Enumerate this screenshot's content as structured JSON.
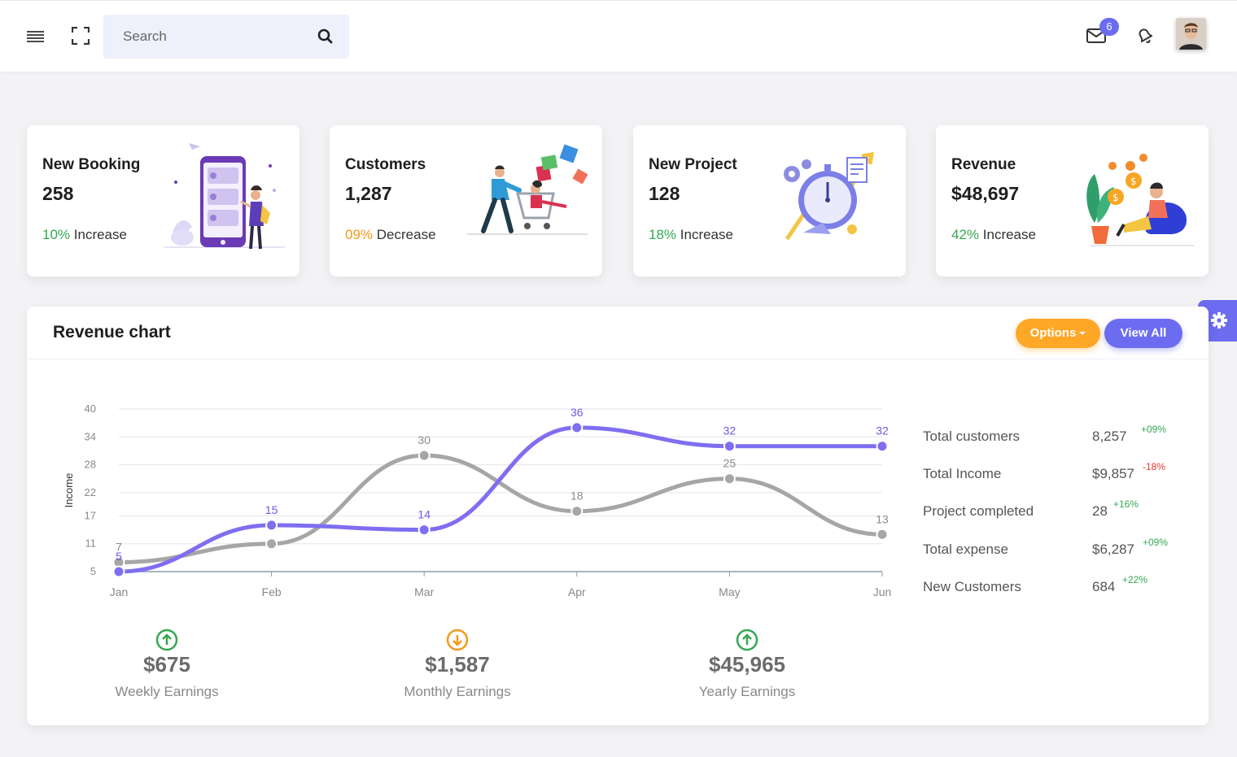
{
  "header": {
    "search_placeholder": "Search",
    "mail_count": "6"
  },
  "cards": [
    {
      "title": "New Booking",
      "value": "258",
      "change_pct": "10%",
      "change_word": "Increase",
      "direction": "up"
    },
    {
      "title": "Customers",
      "value": "1,287",
      "change_pct": "09%",
      "change_word": "Decrease",
      "direction": "down"
    },
    {
      "title": "New Project",
      "value": "128",
      "change_pct": "18%",
      "change_word": "Increase",
      "direction": "up"
    },
    {
      "title": "Revenue",
      "value": "$48,697",
      "change_pct": "42%",
      "change_word": "Increase",
      "direction": "up"
    }
  ],
  "panel": {
    "title": "Revenue chart",
    "options_label": "Options",
    "viewall_label": "View All"
  },
  "chart_data": {
    "type": "line",
    "categories": [
      "Jan",
      "Feb",
      "Mar",
      "Apr",
      "May",
      "Jun"
    ],
    "ylabel": "Income",
    "yticks": [
      "5",
      "11",
      "17",
      "22",
      "28",
      "34",
      "40"
    ],
    "ylim": [
      5,
      40
    ],
    "series": [
      {
        "values": [
          7,
          11,
          30,
          18,
          25,
          13
        ],
        "color": "#a6a6a6",
        "labels": [
          "7",
          "",
          "30",
          "18",
          "25",
          "13"
        ]
      },
      {
        "values": [
          5,
          15,
          14,
          36,
          32,
          32
        ],
        "color": "#7f6ef0",
        "labels": [
          "5",
          "15",
          "14",
          "36",
          "32",
          "32"
        ]
      }
    ],
    "grid": true
  },
  "stats": [
    {
      "label": "Total customers",
      "value": "8,257",
      "delta": "+09%",
      "sign": "pos"
    },
    {
      "label": "Total Income",
      "value": "$9,857",
      "delta": "-18%",
      "sign": "neg"
    },
    {
      "label": "Project completed",
      "value": "28",
      "delta": "+16%",
      "sign": "pos"
    },
    {
      "label": "Total expense",
      "value": "$6,287",
      "delta": "+09%",
      "sign": "pos"
    },
    {
      "label": "New Customers",
      "value": "684",
      "delta": "+22%",
      "sign": "pos"
    }
  ],
  "earnings": [
    {
      "amount": "$675",
      "label": "Weekly Earnings",
      "direction": "up",
      "color": "#34a853"
    },
    {
      "amount": "$1,587",
      "label": "Monthly Earnings",
      "direction": "down",
      "color": "#f39a1b"
    },
    {
      "amount": "$45,965",
      "label": "Yearly Earnings",
      "direction": "up",
      "color": "#34a853"
    }
  ],
  "colors": {
    "accent": "#6c6cf0",
    "warning": "#ffa726",
    "success": "#34a853",
    "danger": "#e53935"
  }
}
